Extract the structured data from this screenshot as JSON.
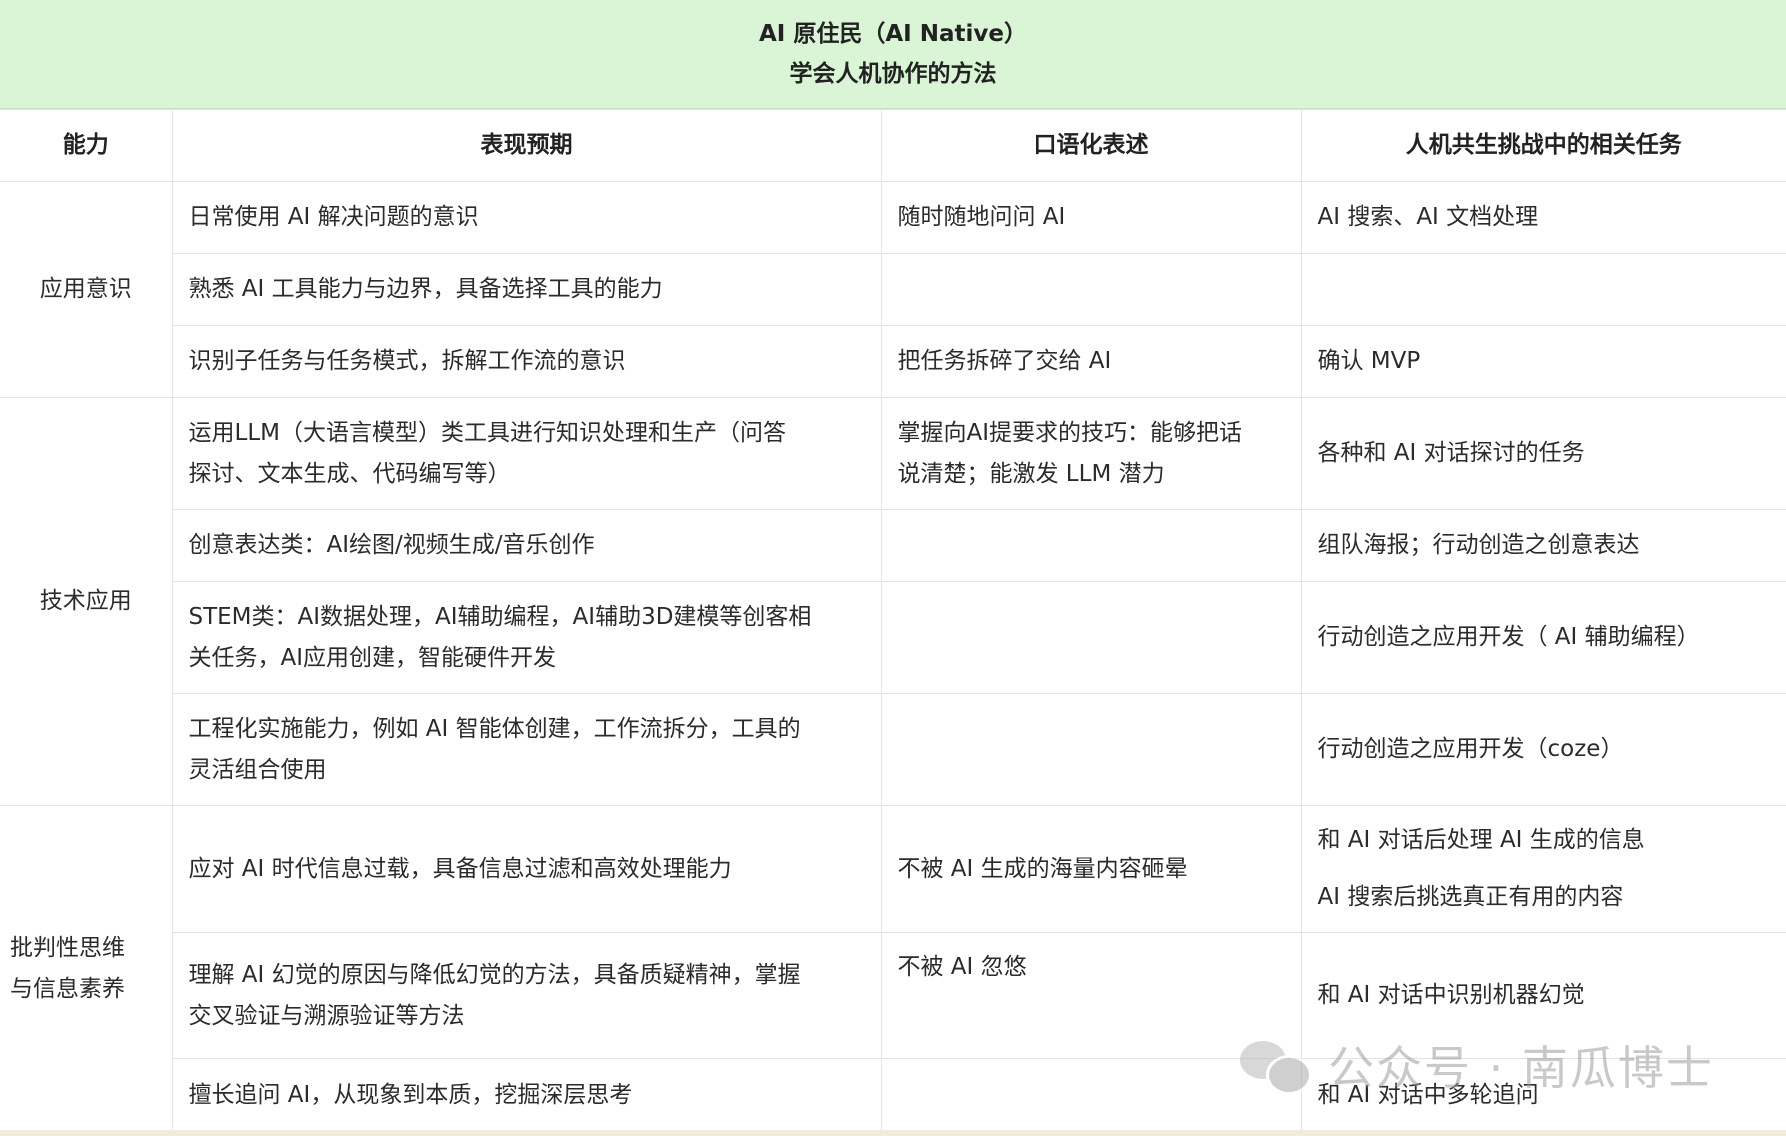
{
  "title": {
    "line1": "AI 原住民（AI Native）",
    "line2": "学会人机协作的方法"
  },
  "headers": [
    "能力",
    "表现预期",
    "口语化表述",
    "人机共生挑战中的相关任务"
  ],
  "groups": [
    {
      "name": "应用意识",
      "rows": [
        {
          "expect": [
            "日常使用 AI 解决问题的意识"
          ],
          "oral": [
            "随时随地问问 AI"
          ],
          "tasks": [
            "AI 搜索、AI 文档处理"
          ]
        },
        {
          "expect": [
            "熟悉 AI 工具能力与边界，具备选择工具的能力"
          ],
          "oral": [],
          "tasks": []
        },
        {
          "expect": [
            "识别子任务与任务模式，拆解工作流的意识"
          ],
          "oral": [
            "把任务拆碎了交给 AI"
          ],
          "tasks": [
            "确认 MVP"
          ]
        }
      ]
    },
    {
      "name": "技术应用",
      "rows": [
        {
          "expect": [
            "运用LLM（大语言模型）类工具进行知识处理和生产（问答",
            "探讨、文本生成、代码编写等）"
          ],
          "oral": [
            "掌握向AI提要求的技巧：能够把话",
            "说清楚；能激发 LLM 潜力"
          ],
          "tasks": [
            "各种和 AI 对话探讨的任务"
          ]
        },
        {
          "expect": [
            "创意表达类：AI绘图/视频生成/音乐创作"
          ],
          "oral": [],
          "tasks": [
            "组队海报；行动创造之创意表达"
          ]
        },
        {
          "expect": [
            "STEM类：AI数据处理，AI辅助编程，AI辅助3D建模等创客相",
            "关任务，AI应用创建，智能硬件开发"
          ],
          "oral": [],
          "tasks": [
            "行动创造之应用开发（ AI 辅助编程）"
          ]
        },
        {
          "expect": [
            "工程化实施能力，例如 AI 智能体创建，工作流拆分，工具的",
            "灵活组合使用"
          ],
          "oral": [],
          "tasks": [
            "行动创造之应用开发（coze）"
          ]
        }
      ]
    },
    {
      "name": [
        "批判性思维",
        "与信息素养"
      ],
      "rows": [
        {
          "expect": [
            "应对 AI 时代信息过载，具备信息过滤和高效处理能力"
          ],
          "oral": [
            "不被 AI 生成的海量内容砸晕"
          ],
          "tasks": [
            "和 AI 对话后处理 AI 生成的信息",
            "AI 搜索后挑选真正有用的内容"
          ]
        },
        {
          "expect": [
            "理解 AI 幻觉的原因与降低幻觉的方法，具备质疑精神，掌握",
            "交叉验证与溯源验证等方法"
          ],
          "oral": [
            "不被 AI 忽悠"
          ],
          "tasks": [
            "和 AI 对话中识别机器幻觉"
          ]
        },
        {
          "expect": [
            "擅长追问 AI，从现象到本质，挖掘深层思考"
          ],
          "oral": [],
          "tasks": [
            "和 AI 对话中多轮追问"
          ]
        }
      ]
    }
  ],
  "watermark": {
    "text": "公众号 · 南瓜博士",
    "icon": "wechat-icon"
  }
}
